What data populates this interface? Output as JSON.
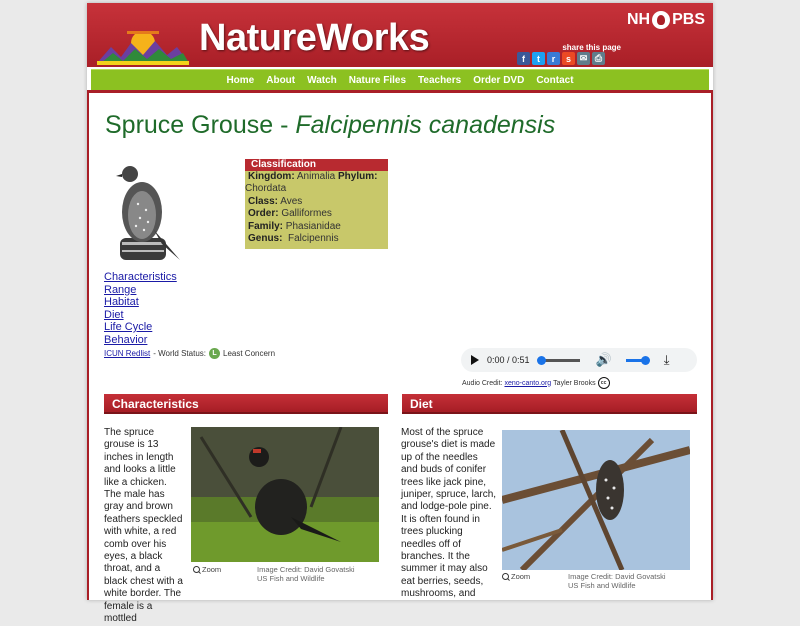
{
  "header": {
    "brand": "NatureWorks",
    "broadcaster_left": "NH",
    "broadcaster_right": "PBS",
    "share_label": "share this page",
    "share_icons": [
      "facebook-icon",
      "twitter-icon",
      "reddit-icon",
      "stumbleupon-icon",
      "email-icon",
      "print-icon"
    ],
    "colors": {
      "header_red": "#b82a30",
      "nav_green": "#8cc121",
      "title_green": "#1f6b2a",
      "class_bg": "#c8c86a"
    }
  },
  "nav": {
    "items": [
      "Home",
      "About",
      "Watch",
      "Nature Files",
      "Teachers",
      "Order DVD",
      "Contact"
    ]
  },
  "main": {
    "title_common": "Spruce Grouse - ",
    "title_latin": "Falcipennis canadensis",
    "links": [
      "Characteristics",
      "Range",
      "Habitat",
      "Diet",
      "Life Cycle",
      "Behavior"
    ],
    "iucn": {
      "link": "ICUN Redlist",
      "text": " - World Status: ",
      "badge": "L",
      "status": "Least Concern"
    }
  },
  "classification": {
    "heading": "Classification",
    "kingdom_label": "Kingdom:",
    "kingdom": " Animalia ",
    "phylum_label": "Phylum:",
    "phylum": "Chordata",
    "class_label": "Class:",
    "class": " Aves",
    "order_label": "Order:",
    "order": " Galliformes",
    "family_label": "Family:",
    "family": " Phasianidae",
    "genus_label": "Genus:",
    "genus": "  Falcipennis"
  },
  "audio": {
    "time": "0:00 / 0:51",
    "progress": 0,
    "credit_prefix": "Audio Credit: ",
    "credit_link": "xeno-canto.org",
    "credit_name": " Tayler Brooks",
    "cc": "cc"
  },
  "sections": {
    "characteristics": {
      "heading": "Characteristics",
      "text": "The spruce grouse is 13 inches in length and looks a little like a chicken. The male has gray and brown feathers speckled with white, a red comb over his eyes, a black throat, and a black chest with a white border. The female is a mottled",
      "zoom": "Zoom",
      "credit_line1": "Image Credit: David Govatski",
      "credit_line2": "US Fish and Wildlife"
    },
    "diet": {
      "heading": "Diet",
      "text": "Most of the spruce grouse's diet is made up of the needles and buds of conifer trees like jack pine, juniper, spruce, larch, and lodge-pole pine. It is often found in trees plucking needles off of branches. It the summer it may also eat berries, seeds, mushrooms, and",
      "zoom": "Zoom",
      "credit_line1": "Image Credit: David Govatski",
      "credit_line2": "US Fish and Wildlife"
    }
  }
}
